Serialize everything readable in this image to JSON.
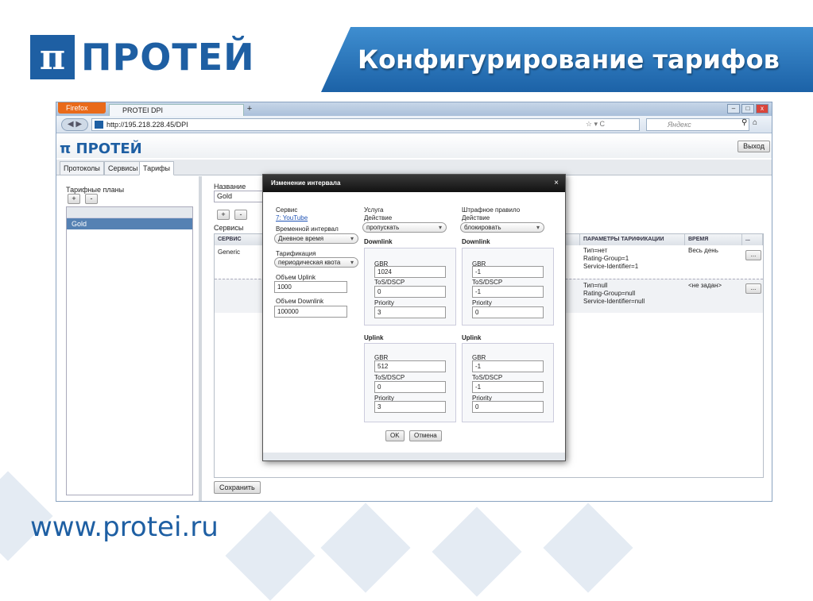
{
  "slide": {
    "logo_pi": "π",
    "logo_text": "ПРОТЕЙ",
    "title": "Конфигурирование тарифов",
    "footer_url": "www.protei.ru"
  },
  "browser": {
    "firefox_label": "Firefox",
    "tab_title": "PROTEI DPI",
    "tab_plus": "+",
    "url": "http://195.218.228.45/DPI",
    "search_placeholder": "Яндекс"
  },
  "app": {
    "logo": "ПРОТЕЙ",
    "exit": "Выход",
    "tabs": [
      "Протоколы",
      "Сервисы",
      "Тарифы"
    ],
    "left": {
      "label": "Тарифные планы",
      "add": "+",
      "remove": "-",
      "plan": "Gold"
    },
    "right": {
      "name_label": "Название",
      "name_value": "Gold",
      "add": "+",
      "remove": "-",
      "services_label": "Сервисы",
      "save": "Сохранить",
      "columns": [
        "СЕРВИС",
        "ПАРАМЕТРЫ ТАРИФИКАЦИИ",
        "ВРЕМЯ",
        "..."
      ],
      "rows": [
        {
          "service": "Generic",
          "params": [
            "Тип=нет",
            "Rating-Group=1",
            "Service-Identifier=1"
          ],
          "time": "Весь день",
          "btn": "..."
        },
        {
          "service": "",
          "params": [
            "Тип=null",
            "Rating-Group=null",
            "Service-Identifier=null"
          ],
          "time": "<не задан>",
          "btn": "..."
        }
      ]
    }
  },
  "modal": {
    "title": "Изменение интервала",
    "close": "×",
    "service_label": "Сервис",
    "service_value": "7: YouTube",
    "interval_label": "Временной интервал",
    "interval_value": "Дневное время",
    "billing_label": "Тарификация",
    "billing_value": "периодическая квота",
    "uplink_vol_label": "Объем Uplink",
    "uplink_vol": "1000",
    "downlink_vol_label": "Объем Downlink",
    "downlink_vol": "100000",
    "usluga": {
      "header": "Услуга",
      "action_label": "Действие",
      "action": "пропускать",
      "downlink": {
        "title": "Downlink",
        "gbr_label": "GBR",
        "gbr": "1024",
        "tos_label": "ToS/DSCP",
        "tos": "0",
        "prio_label": "Priority",
        "prio": "3"
      },
      "uplink": {
        "title": "Uplink",
        "gbr_label": "GBR",
        "gbr": "512",
        "tos_label": "ToS/DSCP",
        "tos": "0",
        "prio_label": "Priority",
        "prio": "3"
      }
    },
    "penalty": {
      "header": "Штрафное правило",
      "action_label": "Действие",
      "action": "блокировать",
      "downlink": {
        "title": "Downlink",
        "gbr_label": "GBR",
        "gbr": "-1",
        "tos_label": "ToS/DSCP",
        "tos": "-1",
        "prio_label": "Priority",
        "prio": "0"
      },
      "uplink": {
        "title": "Uplink",
        "gbr_label": "GBR",
        "gbr": "-1",
        "tos_label": "ToS/DSCP",
        "tos": "-1",
        "prio_label": "Priority",
        "prio": "0"
      }
    },
    "ok": "OK",
    "cancel": "Отмена"
  }
}
